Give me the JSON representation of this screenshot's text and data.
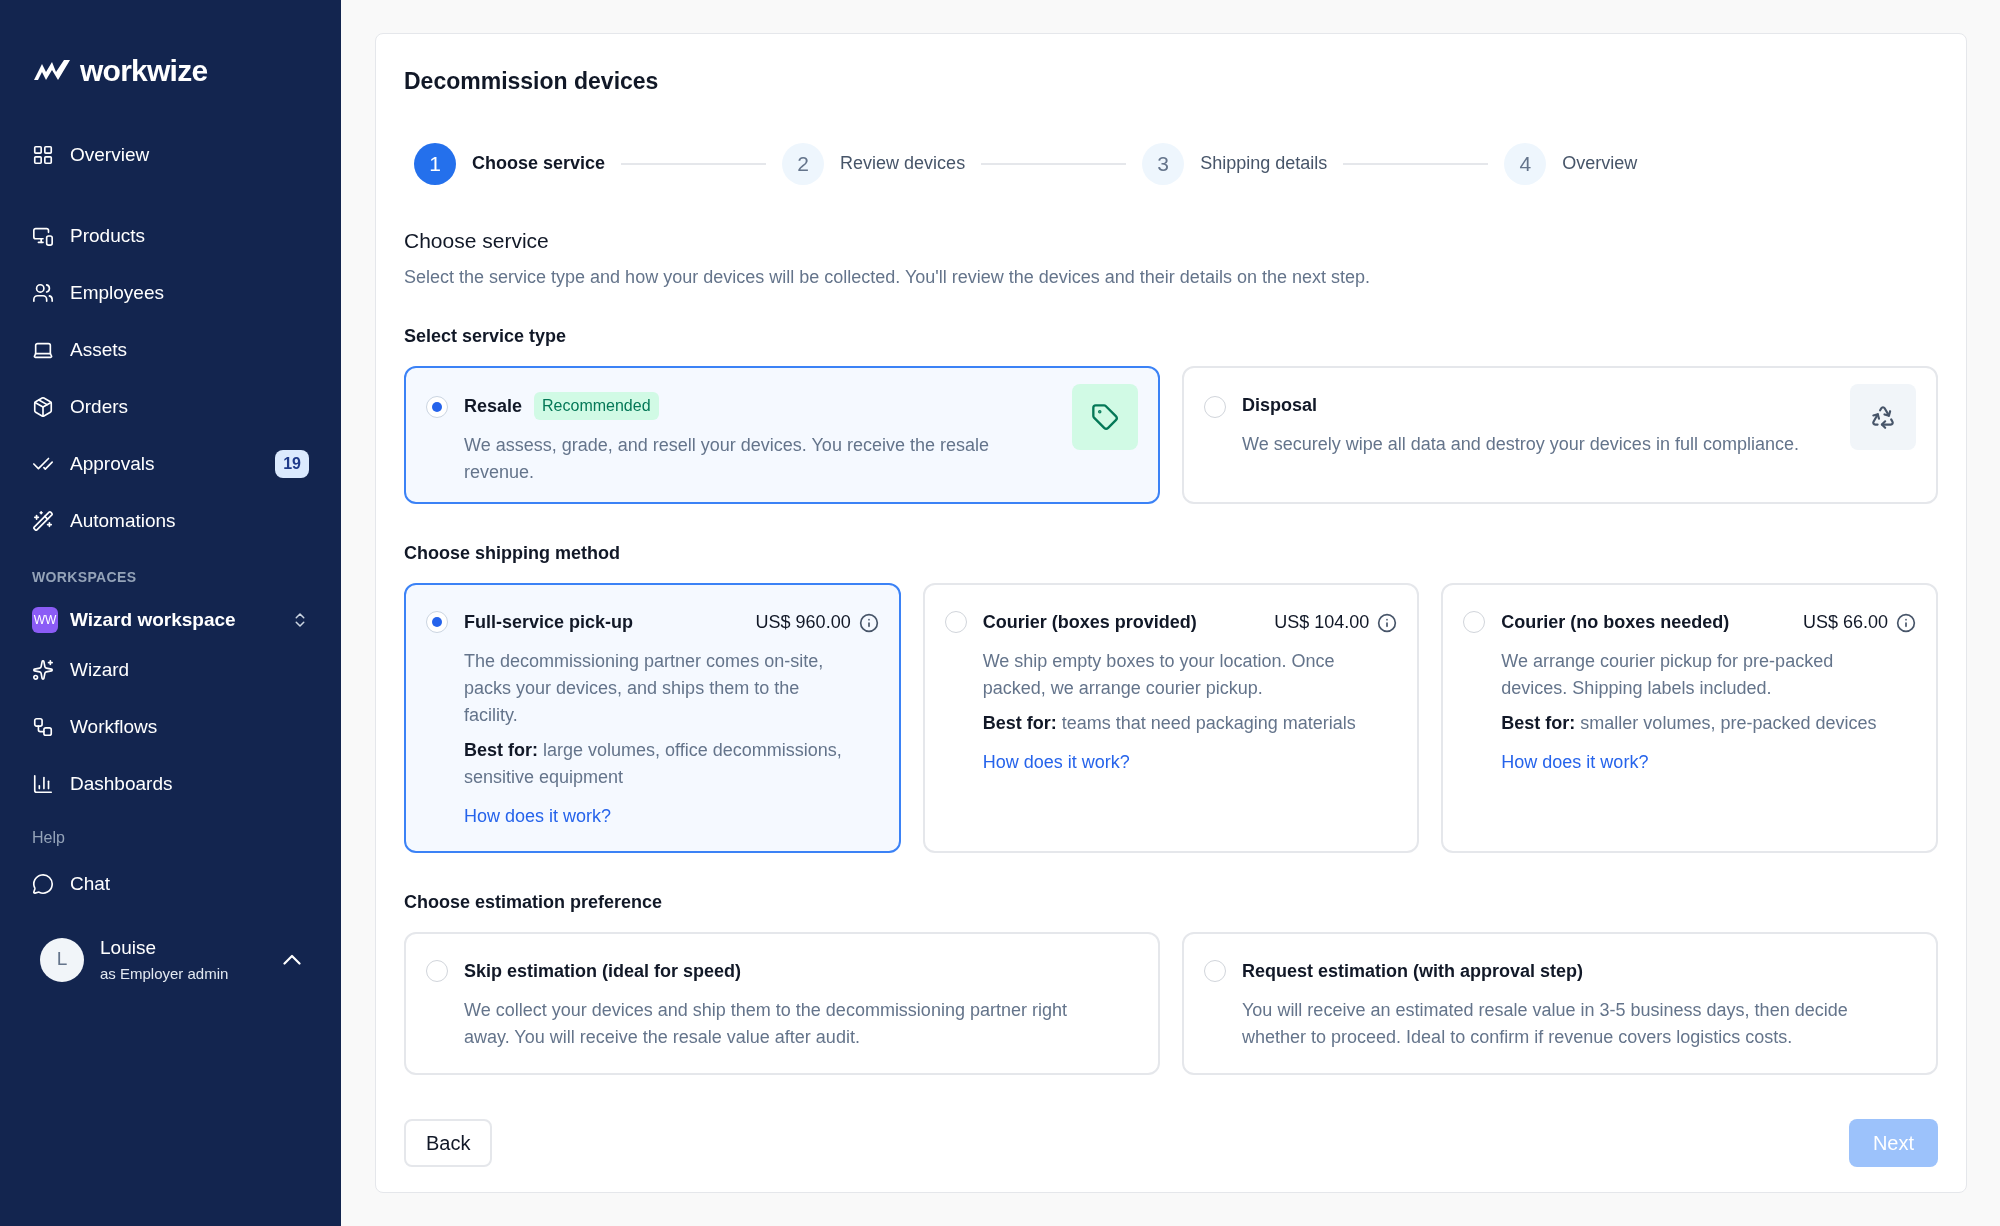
{
  "sidebar": {
    "logo": "workwize",
    "nav": [
      {
        "label": "Overview",
        "selected": false
      },
      {
        "label": "Products",
        "selected": false
      },
      {
        "label": "Employees",
        "selected": false
      },
      {
        "label": "Assets",
        "selected": false
      },
      {
        "label": "Orders",
        "selected": false
      },
      {
        "label": "Approvals",
        "selected": false,
        "badge": "19"
      },
      {
        "label": "Automations",
        "selected": false
      }
    ],
    "workspaces_heading": "WORKSPACES",
    "workspace": {
      "initials": "WW",
      "name": "Wizard workspace"
    },
    "workspace_nav": [
      {
        "label": "Wizard",
        "selected": false
      },
      {
        "label": "Workflows",
        "selected": false
      },
      {
        "label": "Dashboards",
        "selected": false
      }
    ],
    "help_heading": "Help",
    "help_nav": [
      {
        "label": "Chat",
        "selected": false
      }
    ],
    "user": {
      "initial": "L",
      "name": "Louise",
      "role": "as Employer admin"
    }
  },
  "page": {
    "title": "Decommission devices",
    "steps": [
      {
        "number": "1",
        "label": "Choose service",
        "selected": true
      },
      {
        "number": "2",
        "label": "Review devices",
        "selected": false
      },
      {
        "number": "3",
        "label": "Shipping details",
        "selected": false
      },
      {
        "number": "4",
        "label": "Overview",
        "selected": false
      }
    ],
    "section_title": "Choose service",
    "section_description": "Select the service type and how your devices will be collected. You'll review the devices and their details on the next step.",
    "service_type": {
      "heading": "Select service type",
      "options": [
        {
          "title": "Resale",
          "badge": "Recommended",
          "description": "We assess, grade, and resell your devices. You receive the resale revenue.",
          "selected": true
        },
        {
          "title": "Disposal",
          "description": "We securely wipe all data and destroy your devices in full compliance.",
          "selected": false
        }
      ]
    },
    "shipping_method": {
      "heading": "Choose shipping method",
      "options": [
        {
          "title": "Full-service pick-up",
          "price": "US$ 960.00",
          "description": "The decommissioning partner comes on-site, packs your devices, and ships them to the facility.",
          "best_for_label": "Best for:",
          "best_for": "large volumes, office decommissions, sensitive equipment",
          "link": "How does it work?",
          "selected": true
        },
        {
          "title": "Courier (boxes provided)",
          "price": "US$ 104.00",
          "description": "We ship empty boxes to your location. Once packed, we arrange courier pickup.",
          "best_for_label": "Best for:",
          "best_for": "teams that need packaging materials",
          "link": "How does it work?",
          "selected": false
        },
        {
          "title": "Courier (no boxes needed)",
          "price": "US$ 66.00",
          "description": "We arrange courier pickup for pre-packed devices. Shipping labels included.",
          "best_for_label": "Best for:",
          "best_for": "smaller volumes, pre-packed devices",
          "link": "How does it work?",
          "selected": false
        }
      ]
    },
    "estimation": {
      "heading": "Choose estimation preference",
      "options": [
        {
          "title": "Skip estimation (ideal for speed)",
          "description": "We collect your devices and ship them to the decommissioning partner right away. You will receive the resale value after audit.",
          "selected": false
        },
        {
          "title": "Request estimation (with approval step)",
          "description": "You will receive an estimated resale value in 3-5 business days, then decide whether to proceed. Ideal to confirm if revenue covers logistics costs.",
          "selected": false
        }
      ]
    },
    "back_button": "Back",
    "next_button": {
      "label": "Next",
      "disabled": true
    }
  }
}
